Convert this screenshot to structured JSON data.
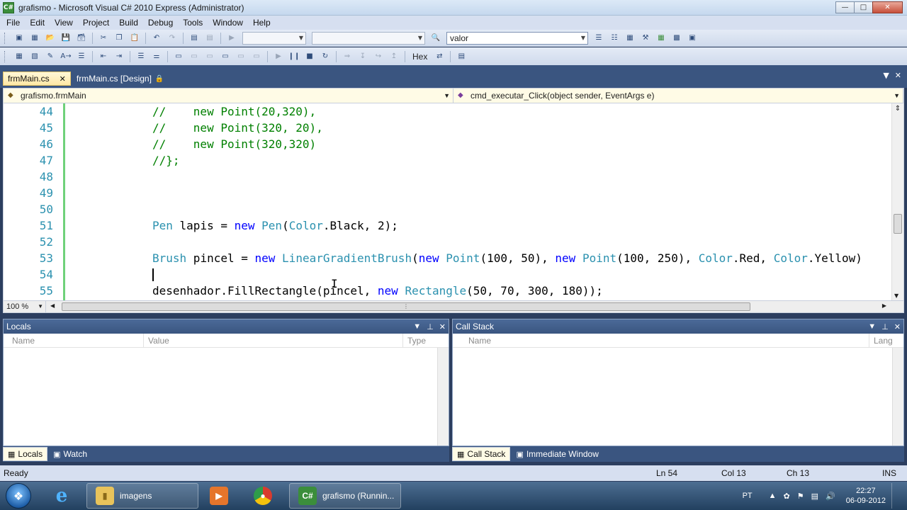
{
  "window": {
    "title": "grafismo - Microsoft Visual C# 2010 Express (Administrator)",
    "app_icon": "visual-csharp-icon",
    "controls": [
      "minimize",
      "maximize",
      "close"
    ]
  },
  "menu": [
    "File",
    "Edit",
    "View",
    "Project",
    "Build",
    "Debug",
    "Tools",
    "Window",
    "Help"
  ],
  "toolbar1": {
    "find_combo_value": "valor"
  },
  "toolbar2": {
    "hex_label": "Hex"
  },
  "document_tabs": [
    {
      "label": "frmMain.cs",
      "active": true
    },
    {
      "label": "frmMain.cs [Design]",
      "active": false
    }
  ],
  "nav": {
    "class_combo": "grafismo.frmMain",
    "member_combo": "cmd_executar_Click(object sender, EventArgs e)"
  },
  "code": {
    "lines": [
      {
        "num": "44",
        "tokens": [
          {
            "t": "//    new Point(20,320),",
            "c": "com"
          }
        ]
      },
      {
        "num": "45",
        "tokens": [
          {
            "t": "//    new Point(320, 20),",
            "c": "com"
          }
        ]
      },
      {
        "num": "46",
        "tokens": [
          {
            "t": "//    new Point(320,320)",
            "c": "com"
          }
        ]
      },
      {
        "num": "47",
        "tokens": [
          {
            "t": "//};",
            "c": "com"
          }
        ]
      },
      {
        "num": "48",
        "tokens": []
      },
      {
        "num": "49",
        "tokens": []
      },
      {
        "num": "50",
        "tokens": []
      },
      {
        "num": "51",
        "tokens": [
          {
            "t": "Pen",
            "c": "type"
          },
          {
            "t": " lapis = ",
            "c": "plain"
          },
          {
            "t": "new",
            "c": "kw"
          },
          {
            "t": " ",
            "c": "plain"
          },
          {
            "t": "Pen",
            "c": "type"
          },
          {
            "t": "(",
            "c": "plain"
          },
          {
            "t": "Color",
            "c": "type"
          },
          {
            "t": ".Black, 2);",
            "c": "plain"
          }
        ]
      },
      {
        "num": "52",
        "tokens": []
      },
      {
        "num": "53",
        "tokens": [
          {
            "t": "Brush",
            "c": "type"
          },
          {
            "t": " pincel = ",
            "c": "plain"
          },
          {
            "t": "new",
            "c": "kw"
          },
          {
            "t": " ",
            "c": "plain"
          },
          {
            "t": "LinearGradientBrush",
            "c": "type"
          },
          {
            "t": "(",
            "c": "plain"
          },
          {
            "t": "new",
            "c": "kw"
          },
          {
            "t": " ",
            "c": "plain"
          },
          {
            "t": "Point",
            "c": "type"
          },
          {
            "t": "(100, 50), ",
            "c": "plain"
          },
          {
            "t": "new",
            "c": "kw"
          },
          {
            "t": " ",
            "c": "plain"
          },
          {
            "t": "Point",
            "c": "type"
          },
          {
            "t": "(100, 250), ",
            "c": "plain"
          },
          {
            "t": "Color",
            "c": "type"
          },
          {
            "t": ".Red, ",
            "c": "plain"
          },
          {
            "t": "Color",
            "c": "type"
          },
          {
            "t": ".Yellow)",
            "c": "plain"
          }
        ]
      },
      {
        "num": "54",
        "tokens": [],
        "caret": true
      },
      {
        "num": "55",
        "tokens": [
          {
            "t": "desenhador.FillRectangle(pincel, ",
            "c": "plain"
          },
          {
            "t": "new",
            "c": "kw"
          },
          {
            "t": " ",
            "c": "plain"
          },
          {
            "t": "Rectangle",
            "c": "type"
          },
          {
            "t": "(50, 70, 300, 180));",
            "c": "plain"
          }
        ]
      }
    ]
  },
  "zoom": "100 %",
  "panels": {
    "locals": {
      "title": "Locals",
      "columns": [
        "Name",
        "Value",
        "Type"
      ]
    },
    "callstack": {
      "title": "Call Stack",
      "columns": [
        "Name",
        "Lang"
      ]
    }
  },
  "panel_tabs_left": [
    "Locals",
    "Watch"
  ],
  "panel_tabs_right": [
    "Call Stack",
    "Immediate Window"
  ],
  "status": {
    "state": "Ready",
    "ln": "Ln 54",
    "col": "Col 13",
    "ch": "Ch 13",
    "mode": "INS"
  },
  "taskbar": {
    "items": [
      {
        "label": "",
        "icon": "internet-explorer-icon"
      },
      {
        "label": "imagens",
        "icon": "folder-icon"
      },
      {
        "label": "",
        "icon": "media-player-icon"
      },
      {
        "label": "",
        "icon": "chrome-icon"
      },
      {
        "label": "grafismo (Runnin...",
        "icon": "visual-csharp-icon"
      }
    ],
    "language": "PT",
    "time": "22:27",
    "date": "06-09-2012"
  },
  "colors": {
    "comment": "#008000",
    "keyword": "#0000ff",
    "type": "#2b91af",
    "line_number": "#2b91af",
    "change_bar": "#6fd17a",
    "active_tab": "#ffe8a6",
    "frame": "#3a5580"
  }
}
